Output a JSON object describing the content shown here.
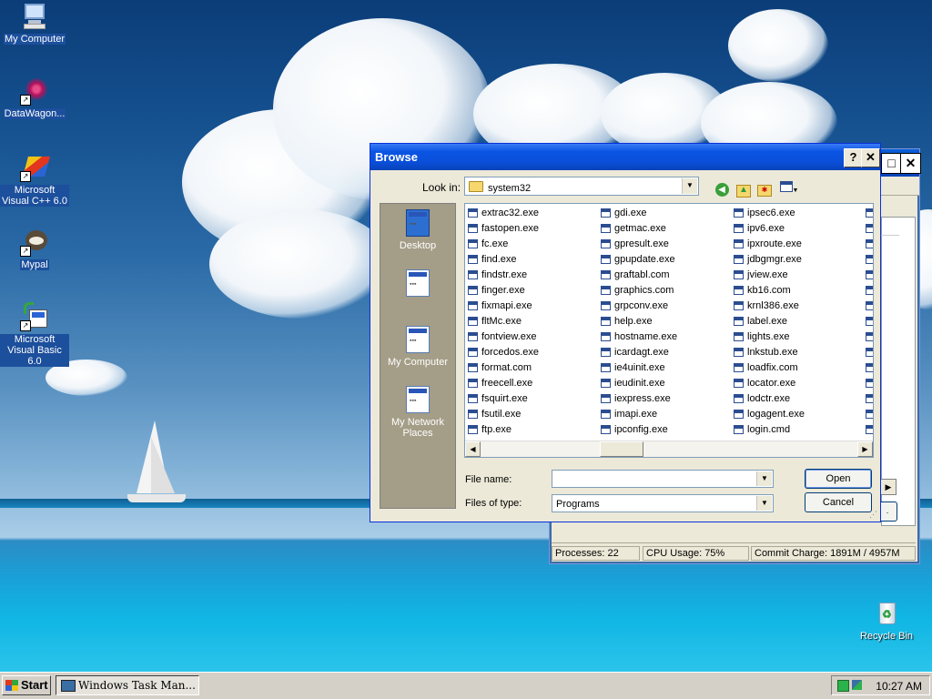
{
  "desktop": {
    "icons": [
      {
        "label": "My Computer",
        "icon": "my-computer-icon"
      },
      {
        "label": "DataWagon...",
        "icon": "datawagon-icon"
      },
      {
        "label": "Microsoft Visual C++ 6.0",
        "icon": "visual-cpp-icon"
      },
      {
        "label": "Mypal",
        "icon": "mypal-icon"
      },
      {
        "label": "Microsoft Visual Basic 6.0",
        "icon": "visual-basic-icon"
      },
      {
        "label": "Recycle Bin",
        "icon": "recycle-bin-icon"
      }
    ]
  },
  "taskmgr": {
    "status": {
      "processes": "Processes: 22",
      "cpu": "CPU Usage: 75%",
      "commit": "Commit Charge: 1891M / 4957M"
    }
  },
  "browse": {
    "title": "Browse",
    "help_label": "?",
    "close_label": "✕",
    "look_in_label": "Look in:",
    "look_in_value": "system32",
    "places": [
      "Desktop",
      "My Computer",
      "My Network Places"
    ],
    "files": {
      "col1": [
        "extrac32.exe",
        "fastopen.exe",
        "fc.exe",
        "find.exe",
        "findstr.exe",
        "finger.exe",
        "fixmapi.exe",
        "fltMc.exe",
        "fontview.exe",
        "forcedos.exe",
        "format.com",
        "freecell.exe",
        "fsquirt.exe",
        "fsutil.exe",
        "ftp.exe"
      ],
      "col2": [
        "gdi.exe",
        "getmac.exe",
        "gpresult.exe",
        "gpupdate.exe",
        "graftabl.com",
        "graphics.com",
        "grpconv.exe",
        "help.exe",
        "hostname.exe",
        "icardagt.exe",
        "ie4uinit.exe",
        "ieudinit.exe",
        "iexpress.exe",
        "imapi.exe",
        "ipconfig.exe"
      ],
      "col3": [
        "ipsec6.exe",
        "ipv6.exe",
        "ipxroute.exe",
        "jdbgmgr.exe",
        "jview.exe",
        "kb16.com",
        "krnl386.exe",
        "label.exe",
        "lights.exe",
        "lnkstub.exe",
        "loadfix.com",
        "locator.exe",
        "lodctr.exe",
        "logagent.exe",
        "login.cmd"
      ]
    },
    "file_name_label": "File name:",
    "file_name_value": "",
    "files_of_type_label": "Files of type:",
    "files_of_type_value": "Programs",
    "open_label": "Open",
    "cancel_label": "Cancel"
  },
  "taskbar": {
    "start_label": "Start",
    "task_label": "Windows Task Man...",
    "clock": "10:27 AM"
  }
}
